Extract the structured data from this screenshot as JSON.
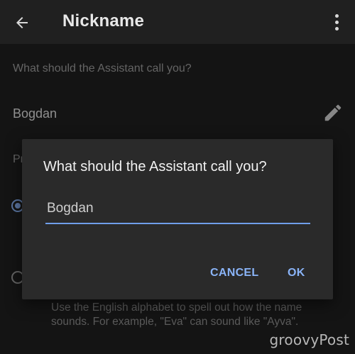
{
  "appbar": {
    "title": "Nickname",
    "back_icon": "arrow-left-icon",
    "overflow_icon": "more-vert-icon"
  },
  "settings": {
    "question": "What should the Assistant call you?",
    "name_value": "Bogdan",
    "edit_icon": "pencil-icon",
    "pronunciation_label": "Pr",
    "hint_text": "Use the English alphabet to spell out how the name sounds. For example, \"Eva\" can sound like \"Ayva\"."
  },
  "dialog": {
    "title": "What should the Assistant call you?",
    "input_value": "Bogdan",
    "cancel_label": "CANCEL",
    "ok_label": "OK"
  },
  "colors": {
    "accent": "#8ab4f8",
    "background": "#202020",
    "dialog": "#2a2a2a"
  },
  "watermark": "groovyPost"
}
